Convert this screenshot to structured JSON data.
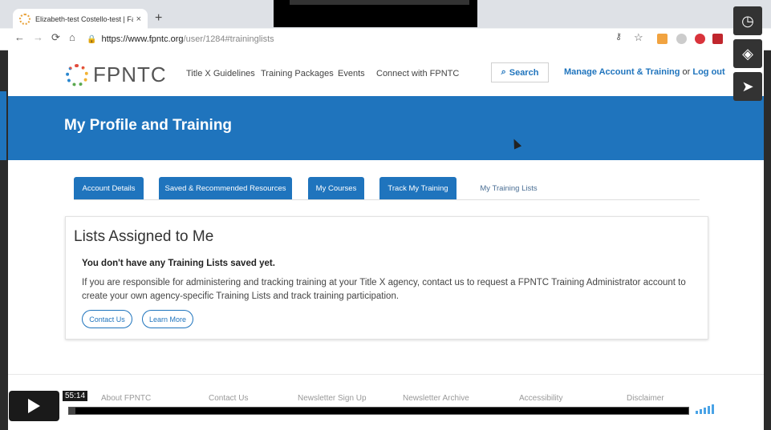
{
  "browser": {
    "tab_title": "Elizabeth-test Costello-test | Fam",
    "tab_close": "×",
    "new_tab": "+",
    "url_domain": "https://www.fpntc.org",
    "url_path": "/user/1284#traininglists"
  },
  "site": {
    "logo_text": "FPNTC",
    "nav": [
      "Title X Guidelines",
      "Training Packages",
      "Events",
      "Connect with FPNTC"
    ],
    "search_label": "Search",
    "manage_account": "Manage Account & Training",
    "or": "or",
    "logout": "Log out"
  },
  "banner": {
    "title": "My Profile and Training"
  },
  "profile_tabs": [
    "Account Details",
    "Saved & Recommended Resources",
    "My Courses",
    "Track My Training",
    "My Training Lists"
  ],
  "card": {
    "heading": "Lists Assigned to Me",
    "empty_message": "You don't have any Training Lists saved yet.",
    "body": "If you are responsible for administering and tracking training at your Title X agency, contact us to request a FPNTC Training Administrator account to create your own agency-specific Training Lists and track training participation.",
    "contact_label": "Contact Us",
    "learn_label": "Learn More"
  },
  "footer_links": [
    "About FPNTC",
    "Contact Us",
    "Newsletter Sign Up",
    "Newsletter Archive",
    "Accessibility",
    "Disclaimer"
  ],
  "player": {
    "timestamp": "55:14",
    "progress_fraction": 0.01
  },
  "colors": {
    "brand_blue": "#1f74bd",
    "player_blue": "#4aa3e6"
  }
}
